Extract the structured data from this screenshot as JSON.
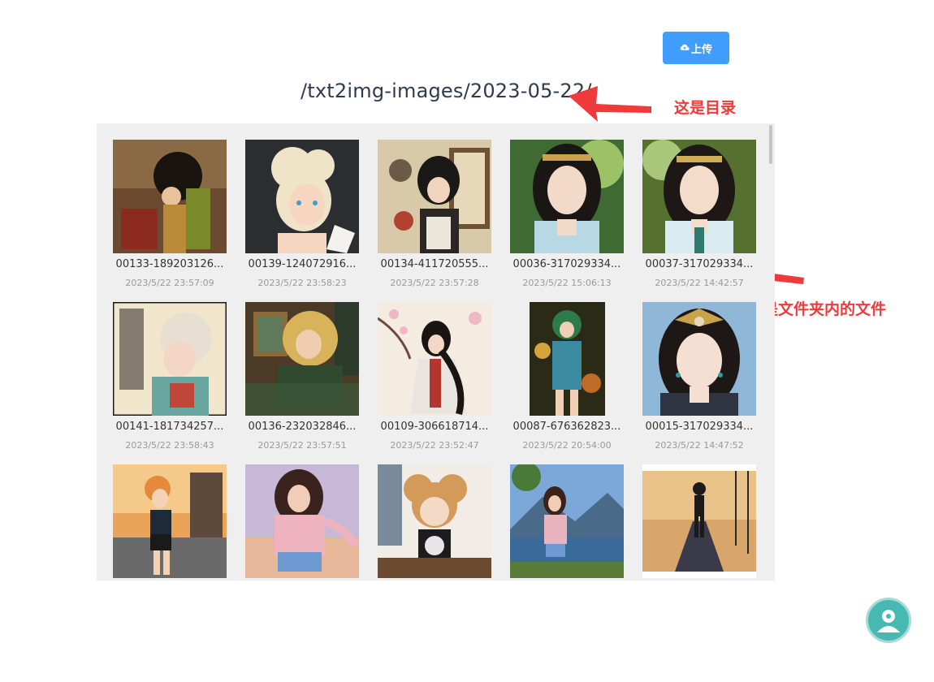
{
  "toolbar": {
    "upload_label": "上传",
    "upload_icon": "cloud-upload-icon",
    "accent_color": "#409eff"
  },
  "path": "/txt2img-images/2023-05-22/",
  "annotations": {
    "directory_note": "这是目录",
    "files_note": "这些都是文件夹内的文件",
    "color": "#ee3a3a"
  },
  "files": [
    {
      "name": "00133-189203126...",
      "date": "2023/5/22 23:57:09"
    },
    {
      "name": "00139-124072916...",
      "date": "2023/5/22 23:58:23"
    },
    {
      "name": "00134-411720555...",
      "date": "2023/5/22 23:57:28"
    },
    {
      "name": "00036-317029334...",
      "date": "2023/5/22 15:06:13"
    },
    {
      "name": "00037-317029334...",
      "date": "2023/5/22 14:42:57"
    },
    {
      "name": "00141-181734257...",
      "date": "2023/5/22 23:58:43"
    },
    {
      "name": "00136-232032846...",
      "date": "2023/5/22 23:57:51"
    },
    {
      "name": "00109-306618714...",
      "date": "2023/5/22 23:52:47"
    },
    {
      "name": "00087-676362823...",
      "date": "2023/5/22 20:54:00"
    },
    {
      "name": "00015-317029334...",
      "date": "2023/5/22 14:47:52"
    },
    {
      "name": "",
      "date": ""
    },
    {
      "name": "",
      "date": ""
    },
    {
      "name": "",
      "date": ""
    },
    {
      "name": "",
      "date": ""
    },
    {
      "name": "",
      "date": ""
    }
  ],
  "help_button_icon": "user-avatar-icon"
}
